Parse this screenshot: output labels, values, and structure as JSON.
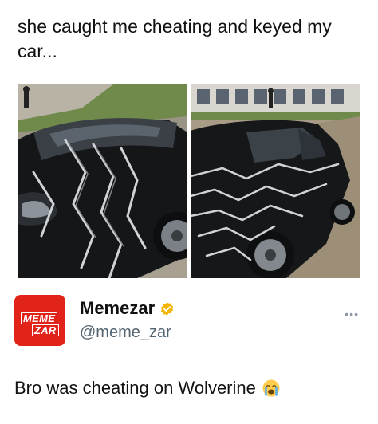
{
  "post": {
    "caption": "she caught me cheating and keyed my car..."
  },
  "images": [
    {
      "alt_icon": "keyed-car-photo-front"
    },
    {
      "alt_icon": "keyed-car-photo-side"
    }
  ],
  "quote": {
    "avatar_text_line1": "MEME",
    "avatar_text_line2": "ZAR",
    "display_name": "Memezar",
    "handle": "@meme_zar",
    "verified_icon": "verified-badge-icon",
    "more_icon": "more-options-icon",
    "text": "Bro was cheating on Wolverine",
    "emoji_icon": "loudly-crying-face-icon"
  },
  "colors": {
    "brand_red": "#e2231a",
    "verified_gold": "#f4b400",
    "handle_gray": "#536471"
  }
}
